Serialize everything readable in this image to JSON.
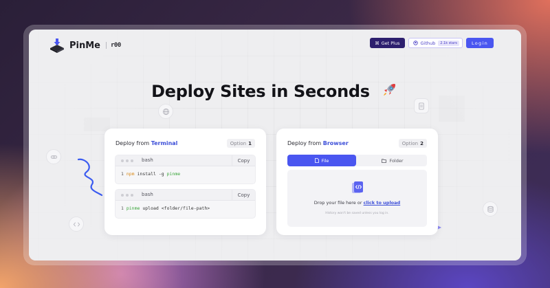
{
  "header": {
    "logo_text": "PinMe",
    "logo_badge": "r00",
    "get_plus_label": "Get Plus",
    "github_label": "Github",
    "github_stars": "2.1k stars",
    "login_label": "Login"
  },
  "hero": {
    "headline": "Deploy Sites in Seconds"
  },
  "terminal_card": {
    "title_prefix": "Deploy from",
    "title_highlight": "Terminal",
    "option_label": "Option",
    "option_number": "1",
    "blocks": [
      {
        "shell": "bash",
        "copy_label": "Copy",
        "line_number": "1",
        "command": "npm",
        "args": "install -g",
        "package": "pinme"
      },
      {
        "shell": "bash",
        "copy_label": "Copy",
        "line_number": "1",
        "command": "pinme",
        "args": "upload <folder/file-path>"
      }
    ]
  },
  "browser_card": {
    "title_prefix": "Deploy from",
    "title_highlight": "Browser",
    "option_label": "Option",
    "option_number": "2",
    "tabs": [
      {
        "label": "File",
        "active": true
      },
      {
        "label": "Folder",
        "active": false
      }
    ],
    "drop_text": "Drop your file here or",
    "drop_link": "click to upload",
    "drop_hint": "History won't be saved unless you log in."
  },
  "colors": {
    "accent": "#4a56f0",
    "highlight": "#3d4fd8",
    "plus_button": "#2d1f6e"
  }
}
